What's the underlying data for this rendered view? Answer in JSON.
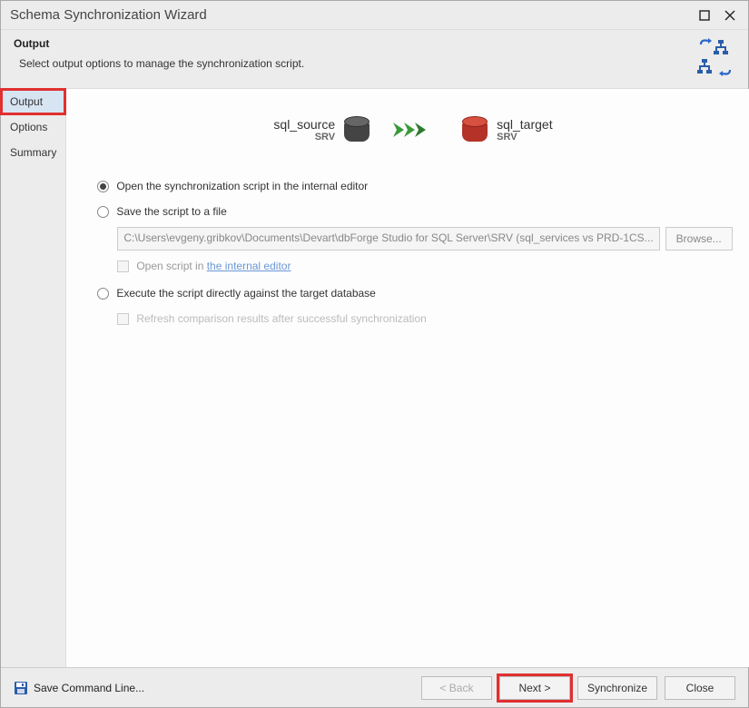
{
  "window": {
    "title": "Schema Synchronization Wizard"
  },
  "header": {
    "title": "Output",
    "subtitle": "Select output options to manage the synchronization script."
  },
  "sidebar": {
    "items": [
      {
        "label": "Output",
        "active": true
      },
      {
        "label": "Options"
      },
      {
        "label": "Summary"
      }
    ]
  },
  "db": {
    "source": {
      "name": "sql_source",
      "sub": "SRV"
    },
    "target": {
      "name": "sql_target",
      "sub": "SRV"
    }
  },
  "options": {
    "radio_open_editor": "Open the synchronization script in the internal editor",
    "radio_save_file": "Save the script to a file",
    "file_path": "C:\\Users\\evgeny.gribkov\\Documents\\Devart\\dbForge Studio for SQL Server\\SRV (sql_services vs PRD-1CS...",
    "browse": "Browse...",
    "open_script_prefix": "Open script in ",
    "open_script_link": "the internal editor",
    "radio_execute": "Execute the script directly against the target database",
    "refresh_check": "Refresh comparison results after successful synchronization"
  },
  "footer": {
    "save_cmd": "Save Command Line...",
    "back": "< Back",
    "next": "Next >",
    "sync": "Synchronize",
    "close": "Close"
  }
}
